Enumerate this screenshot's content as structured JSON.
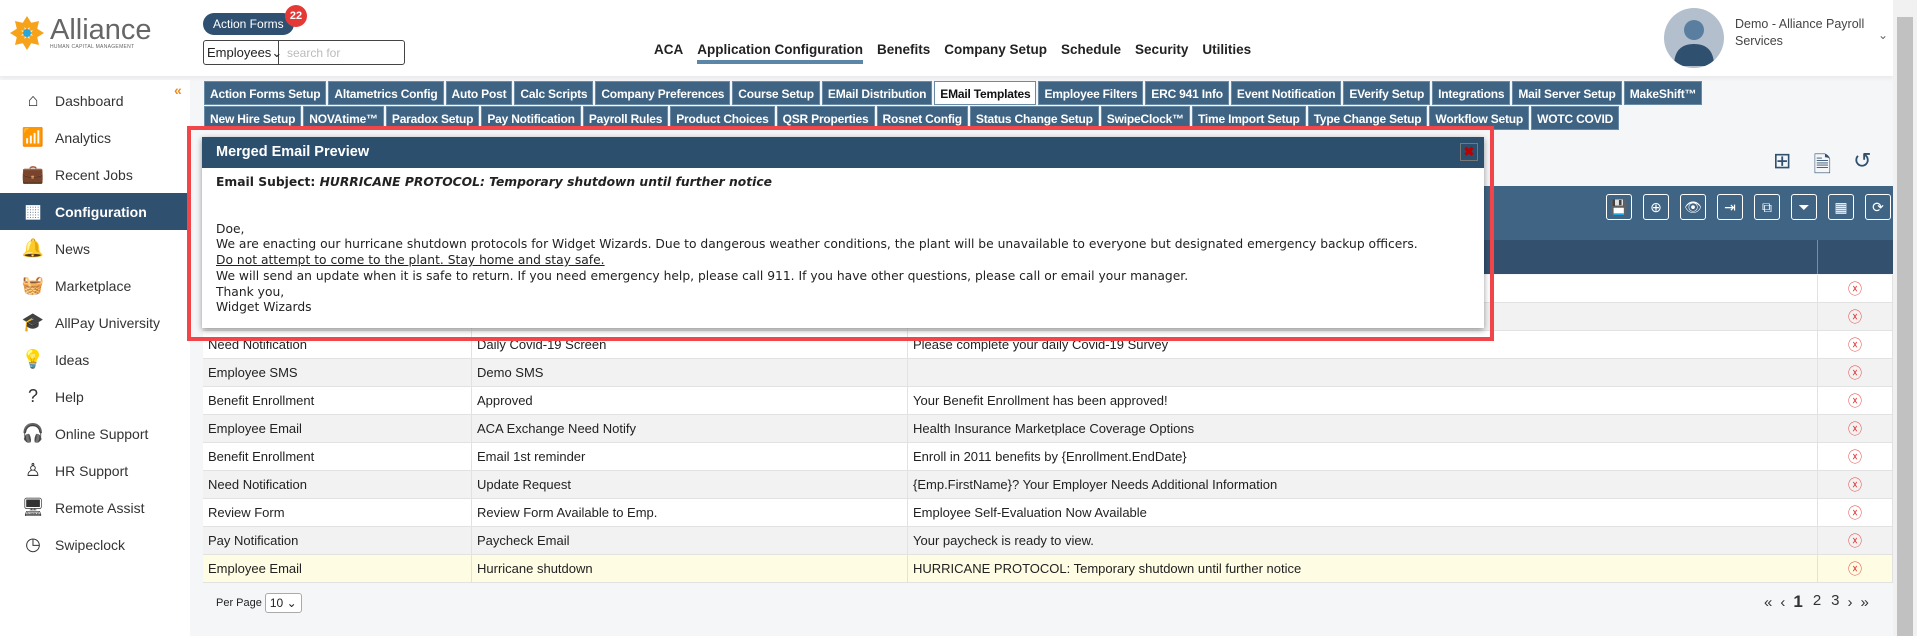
{
  "brand": {
    "name": "Alliance",
    "tagline": "HUMAN CAPITAL MANAGEMENT"
  },
  "header": {
    "action_forms_label": "Action Forms",
    "action_forms_count": "22",
    "search_scope": "Employees",
    "search_placeholder": "search for",
    "nav": [
      "ACA",
      "Application Configuration",
      "Benefits",
      "Company Setup",
      "Schedule",
      "Security",
      "Utilities"
    ],
    "active_nav": "Application Configuration",
    "user": "Demo - Alliance Payroll Services"
  },
  "sidebar": {
    "items": [
      {
        "label": "Dashboard",
        "icon": "home-icon"
      },
      {
        "label": "Analytics",
        "icon": "analytics-icon"
      },
      {
        "label": "Recent Jobs",
        "icon": "briefcase-icon"
      },
      {
        "label": "Configuration",
        "icon": "building-icon",
        "active": true
      },
      {
        "label": "News",
        "icon": "bell-icon"
      },
      {
        "label": "Marketplace",
        "icon": "basket-icon"
      },
      {
        "label": "AllPay University",
        "icon": "graduation-cap-icon"
      },
      {
        "label": "Ideas",
        "icon": "lightbulb-icon"
      },
      {
        "label": "Help",
        "icon": "question-icon"
      },
      {
        "label": "Online Support",
        "icon": "headphones-icon"
      },
      {
        "label": "HR Support",
        "icon": "person-icon"
      },
      {
        "label": "Remote Assist",
        "icon": "monitor-icon"
      },
      {
        "label": "Swipeclock",
        "icon": "clock-icon"
      }
    ]
  },
  "tabs": {
    "row1": [
      "Action Forms Setup",
      "Altametrics Config",
      "Auto Post",
      "Calc Scripts",
      "Company Preferences",
      "Course Setup",
      "EMail Distribution",
      "EMail Templates",
      "Employee Filters",
      "ERC 941 Info",
      "Event Notification",
      "EVerify Setup",
      "Integrations",
      "Mail Server Setup",
      "MakeShift™"
    ],
    "row2": [
      "New Hire Setup",
      "NOVAtime™",
      "Paradox Setup",
      "Pay Notification",
      "Payroll Rules",
      "Product Choices",
      "QSR Properties",
      "Rosnet Config",
      "Status Change Setup",
      "SwipeClock™",
      "Time Import Setup",
      "Type Change Setup",
      "Workflow Setup",
      "WOTC COVID"
    ],
    "active": "EMail Templates"
  },
  "toolbar": [
    "save-icon",
    "add-icon",
    "preview-icon",
    "export-icon",
    "copy-icon",
    "filter-icon",
    "grid-icon",
    "refresh-icon"
  ],
  "table": {
    "rows": [
      [
        "",
        "",
        ""
      ],
      [
        "",
        "",
        ""
      ],
      [
        "Need Notification",
        "Daily Covid-19 Screen",
        "Please complete your daily Covid-19 Survey"
      ],
      [
        "Employee SMS",
        "Demo SMS",
        ""
      ],
      [
        "Benefit Enrollment",
        "Approved",
        "Your Benefit Enrollment has been approved!"
      ],
      [
        "Employee Email",
        "ACA Exchange Need Notify",
        "Health Insurance Marketplace Coverage Options"
      ],
      [
        "Benefit Enrollment",
        "Email 1st reminder",
        "Enroll in 2011 benefits by {Enrollment.EndDate}"
      ],
      [
        "Need Notification",
        "Update Request",
        "{Emp.FirstName}? Your Employer Needs Additional Information"
      ],
      [
        "Review Form",
        "Review Form Available to Emp.",
        "Employee Self-Evaluation Now Available"
      ],
      [
        "Pay Notification",
        "Paycheck Email",
        "Your paycheck is ready to view."
      ],
      [
        "Employee Email",
        "Hurricane shutdown",
        "HURRICANE PROTOCOL: Temporary shutdown until further notice"
      ]
    ],
    "selected_row": 10
  },
  "pagination": {
    "per_page_label": "Per Page",
    "per_page": "10",
    "pages": [
      "1",
      "2",
      "3"
    ],
    "current": "1"
  },
  "modal": {
    "title": "Merged Email Preview",
    "subject_label": "Email Subject:",
    "subject": "HURRICANE PROTOCOL: Temporary shutdown until further notice",
    "greeting": "Doe,",
    "line1": "We are enacting our hurricane shutdown protocols for Widget Wizards. Due to dangerous weather conditions, the plant will be unavailable to everyone but designated emergency backup officers.",
    "line2": "Do not attempt to come to the plant. Stay home and stay safe.",
    "line3": "We will send an update when it is safe to return. If you need emergency help, please call 911. If you have other questions, please call or email your manager.",
    "closing": "Thank you,",
    "signature": "Widget Wizards"
  },
  "colors": {
    "primary": "#30506f",
    "tab": "#3f6382",
    "highlight": "#f2454a",
    "selected_row": "#fefce3",
    "delete": "#e53935"
  }
}
